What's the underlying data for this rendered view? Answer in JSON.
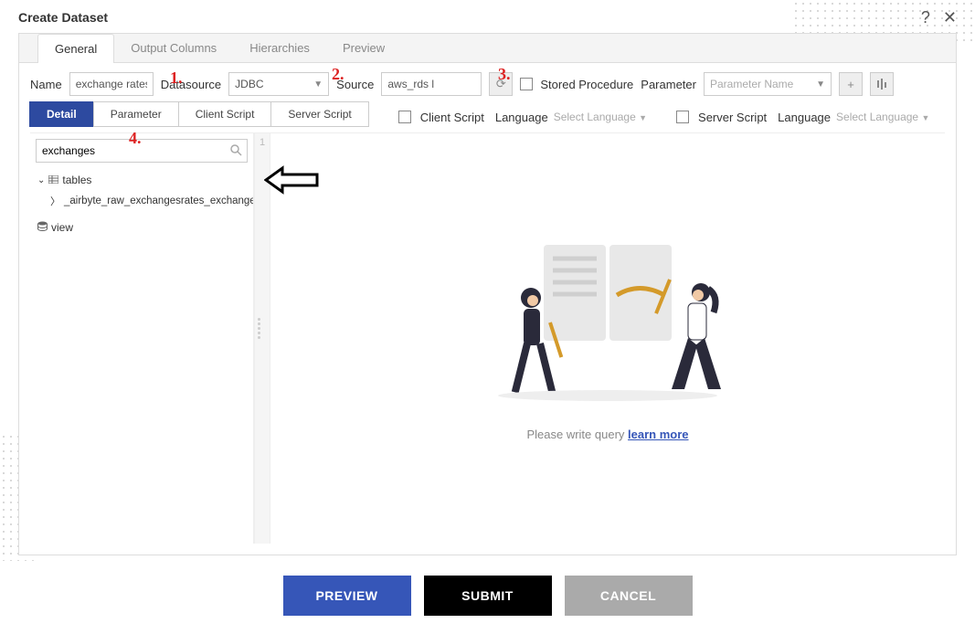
{
  "dialog": {
    "title": "Create Dataset"
  },
  "tabs": {
    "general": "General",
    "output_columns": "Output Columns",
    "hierarchies": "Hierarchies",
    "preview": "Preview"
  },
  "form": {
    "name_label": "Name",
    "name_value": "exchange rates",
    "datasource_label": "Datasource",
    "datasource_value": "JDBC",
    "source_label": "Source",
    "source_value": "aws_rds l",
    "stored_proc_label": "Stored Procedure",
    "parameter_label": "Parameter",
    "parameter_placeholder": "Parameter Name"
  },
  "subtabs": {
    "detail": "Detail",
    "parameter": "Parameter",
    "client_script": "Client Script",
    "server_script": "Server Script"
  },
  "script_row": {
    "client_script_label": "Client Script",
    "language_label": "Language",
    "select_language": "Select Language",
    "server_script_label": "Server Script"
  },
  "sidebar": {
    "search_value": "exchanges",
    "tables_label": "tables",
    "table_item": "_airbyte_raw_exchangesrates_exchange_rates",
    "view_label": "view"
  },
  "editor": {
    "line1": "1",
    "hint_prefix": "Please write query",
    "hint_link": "learn more"
  },
  "buttons": {
    "preview": "PREVIEW",
    "submit": "SUBMIT",
    "cancel": "CANCEL"
  },
  "annotations": {
    "one": "1.",
    "two": "2.",
    "three": "3.",
    "four": "4."
  }
}
